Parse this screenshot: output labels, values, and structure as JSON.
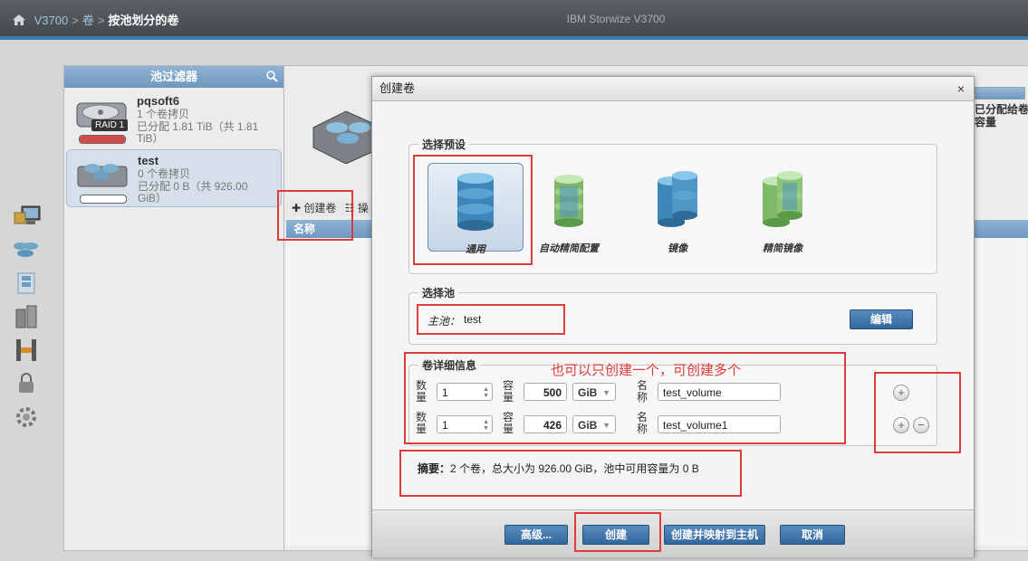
{
  "breadcrumb": {
    "root": "V3700",
    "level1": "卷",
    "current": "按池划分的卷"
  },
  "app_title": "IBM Storwize V3700",
  "pool_filter": {
    "title": "池过滤器",
    "pools": [
      {
        "name": "pqsoft6",
        "line1": "1 个卷拷贝",
        "line2": "已分配 1.81 TiB（共 1.81 TiB）",
        "raid": "RAID 1",
        "usage": 1.0
      },
      {
        "name": "test",
        "line1": "0 个卷拷贝",
        "line2": "已分配 0 B（共 926.00 GiB）",
        "usage": 0.0
      }
    ]
  },
  "main": {
    "toolbar_create": "✚ 创建卷",
    "toolbar_more": "☷ 操",
    "table_col_name": "名称"
  },
  "right_frag": {
    "line1": "已分配给卷",
    "line2": "容量"
  },
  "dialog": {
    "title": "创建卷",
    "close": "×",
    "preset_legend": "选择预设",
    "presets": [
      "通用",
      "自动精简配置",
      "镜像",
      "精简镜像"
    ],
    "pool_legend": "选择池",
    "primary_pool_label": "主池：",
    "primary_pool_value": "test",
    "edit_button": "编辑",
    "details_legend": "卷详细信息",
    "annotation": "也可以只创建一个，可创建多个",
    "labels": {
      "qty": "数量",
      "cap": "容量",
      "name": "名称"
    },
    "rows": [
      {
        "qty": "1",
        "cap": "500",
        "unit": "GiB",
        "name": "test_volume"
      },
      {
        "qty": "1",
        "cap": "426",
        "unit": "GiB",
        "name": "test_volume1"
      }
    ],
    "summary_label": "摘要：",
    "summary_text": "2 个卷，总大小为 926.00 GiB，池中可用容量为 0 B",
    "buttons": {
      "advanced": "高级...",
      "create": "创建",
      "create_map": "创建并映射到主机",
      "cancel": "取消"
    }
  }
}
